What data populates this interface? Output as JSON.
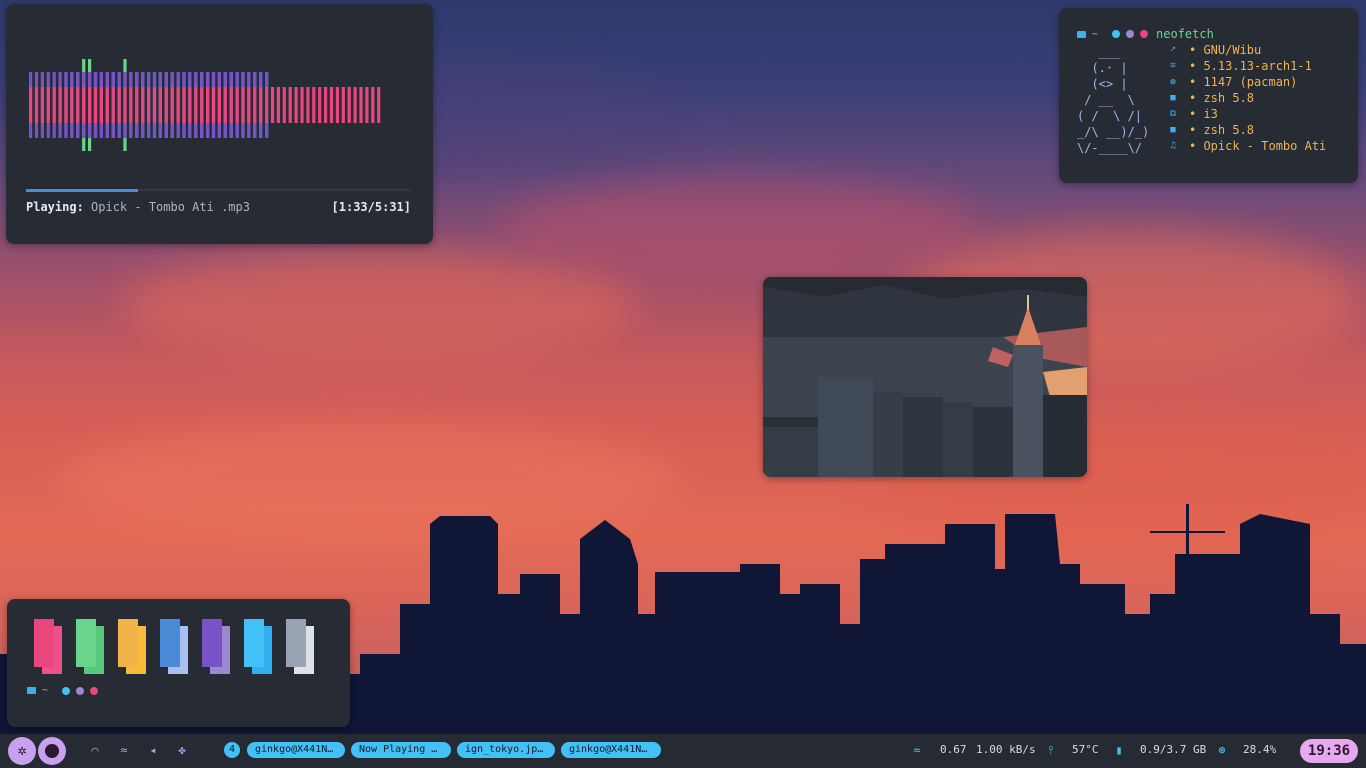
{
  "player": {
    "playing_label": "Playing:",
    "track": "Opick - Tombo Ati .mp3",
    "time": "[1:33/5:31]",
    "progress": 0.29,
    "colors": {
      "pink": "#e8467c",
      "purple": "#7a52c8",
      "cyan": "#43c0f5",
      "green": "#6ad58a",
      "progress": "#4a8ad6"
    }
  },
  "neofetch": {
    "dir": "~",
    "command": "neofetch",
    "ascii": "   ___\n  (.· |\n  (<> |\n / __  \\\n( /  \\ /|\n_/\\ __)/_)\n\\/-____\\/",
    "rows": [
      {
        "icon": "arch-icon",
        "glyph": "➚",
        "value": "• GNU/Wibu"
      },
      {
        "icon": "layers-icon",
        "glyph": "≋",
        "value": "• 5.13.13-arch1-1"
      },
      {
        "icon": "package-icon",
        "glyph": "◍",
        "value": "• 1147 (pacman)"
      },
      {
        "icon": "terminal-icon",
        "glyph": "■",
        "value": "• zsh 5.8"
      },
      {
        "icon": "window-icon",
        "glyph": "⧉",
        "value": "• i3"
      },
      {
        "icon": "terminal-icon",
        "glyph": "■",
        "value": "• zsh 5.8"
      },
      {
        "icon": "music-icon",
        "glyph": "♫",
        "value": "• Opick - Tombo Ati"
      }
    ]
  },
  "palette": {
    "dir": "~",
    "swatches": [
      {
        "front": "#e8467c",
        "back": "#f0508a"
      },
      {
        "front": "#6ad58a",
        "back": "#58c87a"
      },
      {
        "front": "#f0b44a",
        "back": "#f8bc3a"
      },
      {
        "front": "#4a8ad6",
        "back": "#a8c0f0"
      },
      {
        "front": "#7a52c8",
        "back": "#9a88d0"
      },
      {
        "front": "#43c0f5",
        "back": "#30b0f0"
      },
      {
        "front": "#9aa3b4",
        "back": "#dde2ea"
      }
    ]
  },
  "bar": {
    "workspace": "4",
    "windows": [
      "ginkgo@X441N…",
      "Now Playing …",
      "ign_tokyo.jp…",
      "ginkgo@X441N…"
    ],
    "load": "0.67",
    "net": "1.00 kB/s",
    "temp": "57°C",
    "mem": "0.9/3.7 GB",
    "cpu": "28.4%",
    "clock": "19:36"
  },
  "terminal_dot_colors": [
    "#43c0f5",
    "#9a88d0",
    "#e8467c"
  ]
}
